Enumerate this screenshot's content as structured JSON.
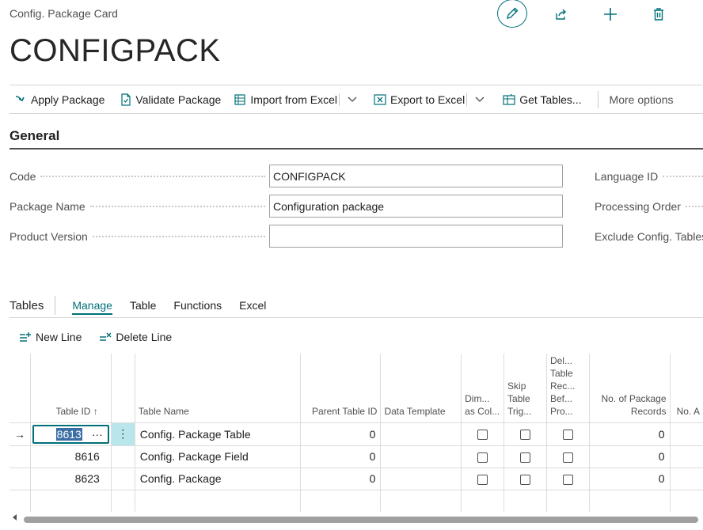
{
  "header": {
    "breadcrumb": "Config. Package Card",
    "title": "CONFIGPACK"
  },
  "actions": {
    "apply": "Apply Package",
    "validate": "Validate Package",
    "import_excel": "Import from Excel",
    "export_excel": "Export to Excel",
    "get_tables": "Get Tables...",
    "more": "More options"
  },
  "general": {
    "title": "General",
    "code_label": "Code",
    "code_value": "CONFIGPACK",
    "name_label": "Package Name",
    "name_value": "Configuration package",
    "version_label": "Product Version",
    "version_value": "",
    "language_label": "Language ID",
    "processing_label": "Processing Order",
    "exclude_label": "Exclude Config. Tables"
  },
  "tables_part": {
    "title": "Tables",
    "tabs": [
      "Manage",
      "Table",
      "Functions",
      "Excel"
    ],
    "new_line": "New Line",
    "delete_line": "Delete Line",
    "headers": {
      "table_id": "Table ID",
      "sort_arrow": "↑",
      "table_name": "Table Name",
      "parent_table_id": "Parent Table ID",
      "data_template": "Data Template",
      "dim_as_col": "Dim... as Col...",
      "skip_trig": "Skip Table Trig...",
      "del_table": "Del... Table Rec... Bef... Pro...",
      "no_records": "No. of Package Records",
      "no_next": "No. A"
    },
    "rows": [
      {
        "table_id": "8613",
        "table_name": "Config. Package Table",
        "parent": "0",
        "records": "0",
        "selected": true
      },
      {
        "table_id": "8616",
        "table_name": "Config. Package Field",
        "parent": "0",
        "records": "0",
        "selected": false
      },
      {
        "table_id": "8623",
        "table_name": "Config. Package",
        "parent": "0",
        "records": "0",
        "selected": false
      }
    ],
    "row_arrow": "→",
    "ellipsis": "···",
    "kebab": "⋮"
  },
  "colors": {
    "accent": "#00707a",
    "selection": "#3a6ea5",
    "row_highlight": "#b9e6ea"
  }
}
